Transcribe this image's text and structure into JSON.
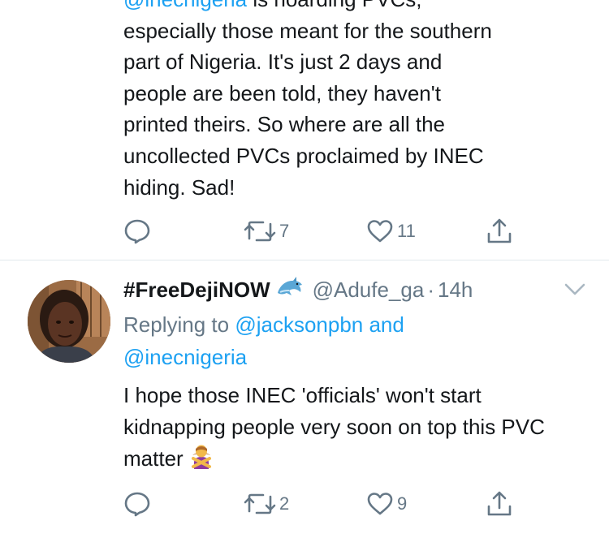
{
  "tweet1": {
    "text_mention": "@inecnigeria",
    "text_after_mention": " is hoarding PVCs,",
    "text_rest": "especially those meant for the southern\npart of Nigeria. It's just 2 days and\npeople are been told, they haven't\nprinted theirs. So where are all the\nuncollected PVCs proclaimed by INEC\nhiding. Sad!",
    "retweets": "7",
    "likes": "11"
  },
  "tweet2": {
    "display_name": "#FreeDejiNOW",
    "handle": "@Adufe_ga",
    "dot": "·",
    "timestamp": "14h",
    "replying_prefix": "Replying to ",
    "replying_to_1": "@jacksonpbn",
    "replying_and": " and",
    "replying_to_2": "@inecnigeria",
    "text": "I hope those INEC 'officials' won't start kidnapping people very soon on top this PVC matter",
    "retweets": "2",
    "likes": "9"
  },
  "icons": {
    "reply": "reply-icon",
    "retweet": "retweet-icon",
    "like": "heart-icon",
    "share": "share-icon",
    "dolphin": "dolphin-emoji",
    "gesture": "person-gesturing-no-emoji",
    "chevron": "chevron-down-icon"
  },
  "colors": {
    "link": "#1da1f2",
    "muted": "#657786",
    "text": "#14171a",
    "divider": "#e1e8ed"
  }
}
